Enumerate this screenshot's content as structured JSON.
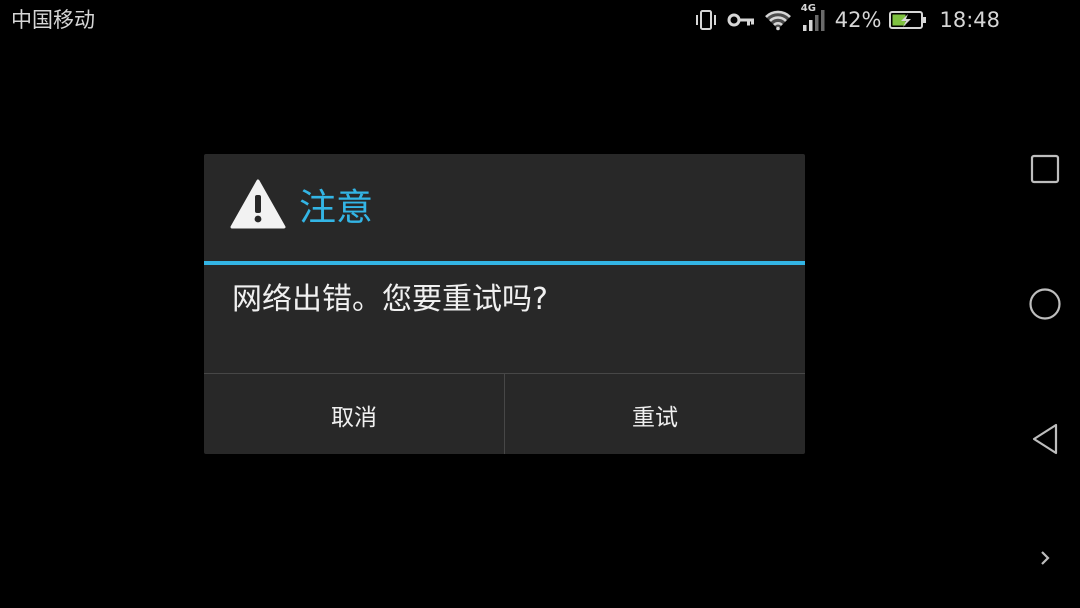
{
  "status_bar": {
    "carrier": "中国移动",
    "network_type": "4G",
    "battery_percent": "42%",
    "time": "18:48",
    "icons": [
      "vibrate-icon",
      "vpn-key-icon",
      "wifi-icon",
      "signal-icon",
      "battery-charging-icon"
    ]
  },
  "dialog": {
    "title": "注意",
    "icon": "warning-icon",
    "message": "网络出错。您要重试吗?",
    "buttons": {
      "cancel": "取消",
      "retry": "重试"
    },
    "accent_color": "#33b5e5",
    "background_color": "#282828"
  },
  "nav_bar": {
    "icons": [
      "recent-apps-icon",
      "home-icon",
      "back-icon",
      "expand-icon"
    ]
  }
}
